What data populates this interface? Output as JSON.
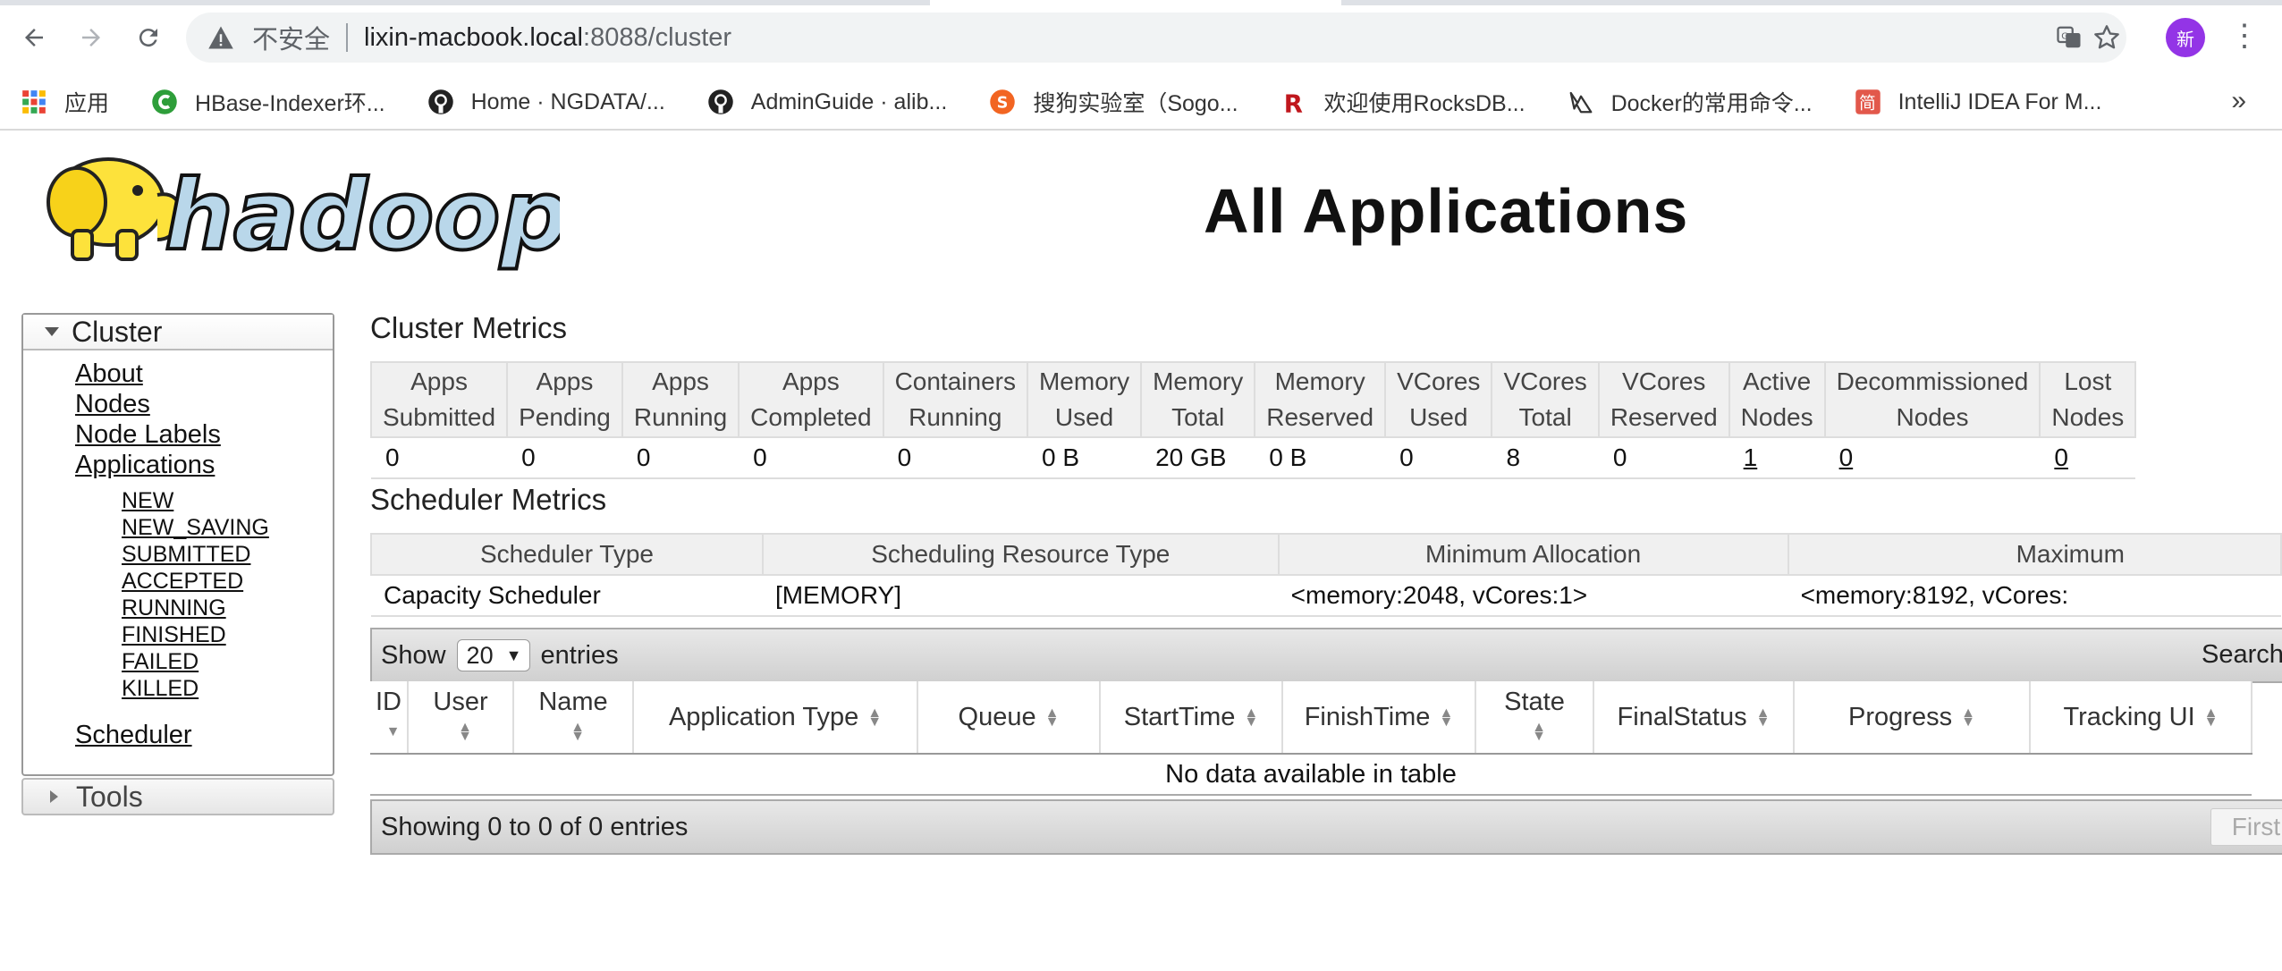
{
  "browser": {
    "insecure_label": "不安全",
    "url_host": "lixin-macbook.local",
    "url_rest": ":8088/cluster",
    "avatar_text": "新",
    "bookmarks": [
      {
        "label": "应用",
        "icon": "apps-grid-icon"
      },
      {
        "label": "HBase-Indexer环...",
        "icon": "c-logo-icon"
      },
      {
        "label": "Home · NGDATA/...",
        "icon": "github-icon"
      },
      {
        "label": "AdminGuide · alib...",
        "icon": "github-icon"
      },
      {
        "label": "搜狗实验室（Sogo...",
        "icon": "sogou-icon"
      },
      {
        "label": "欢迎使用RocksDB...",
        "icon": "rocksdb-icon"
      },
      {
        "label": "Docker的常用命令...",
        "icon": "docker-icon"
      },
      {
        "label": "IntelliJ IDEA For M...",
        "icon": "jian-icon"
      }
    ],
    "more": "»"
  },
  "page": {
    "title": "All Applications",
    "logo_text": "hadoop"
  },
  "sidebar": {
    "cluster_header": "Cluster",
    "links": [
      "About",
      "Nodes",
      "Node Labels",
      "Applications"
    ],
    "app_states": [
      "NEW",
      "NEW_SAVING",
      "SUBMITTED",
      "ACCEPTED",
      "RUNNING",
      "FINISHED",
      "FAILED",
      "KILLED"
    ],
    "scheduler": "Scheduler",
    "tools_header": "Tools"
  },
  "cluster_metrics": {
    "title": "Cluster Metrics",
    "headers": [
      [
        "Apps",
        "Submitted"
      ],
      [
        "Apps",
        "Pending"
      ],
      [
        "Apps",
        "Running"
      ],
      [
        "Apps",
        "Completed"
      ],
      [
        "Containers",
        "Running"
      ],
      [
        "Memory",
        "Used"
      ],
      [
        "Memory",
        "Total"
      ],
      [
        "Memory",
        "Reserved"
      ],
      [
        "VCores",
        "Used"
      ],
      [
        "VCores",
        "Total"
      ],
      [
        "VCores",
        "Reserved"
      ],
      [
        "Active",
        "Nodes"
      ],
      [
        "Decommissioned",
        "Nodes"
      ],
      [
        "Lost",
        "Nodes"
      ]
    ],
    "values": [
      "0",
      "0",
      "0",
      "0",
      "0",
      "0 B",
      "20 GB",
      "0 B",
      "0",
      "8",
      "0",
      "1",
      "0",
      "0"
    ]
  },
  "scheduler_metrics": {
    "title": "Scheduler Metrics",
    "headers": [
      "Scheduler Type",
      "Scheduling Resource Type",
      "Minimum Allocation",
      "Maximum"
    ],
    "values": [
      "Capacity Scheduler",
      "[MEMORY]",
      "<memory:2048, vCores:1>",
      "<memory:8192, vCores:"
    ]
  },
  "apps_table": {
    "show_label": "Show",
    "entries_value": "20",
    "entries_label": "entries",
    "search_label": "Search",
    "headers": [
      "ID",
      "User",
      "Name",
      "Application Type",
      "Queue",
      "StartTime",
      "FinishTime",
      "State",
      "FinalStatus",
      "Progress",
      "Tracking UI"
    ],
    "empty_message": "No data available in table",
    "footer_info": "Showing 0 to 0 of 0 entries",
    "first_button": "First"
  }
}
